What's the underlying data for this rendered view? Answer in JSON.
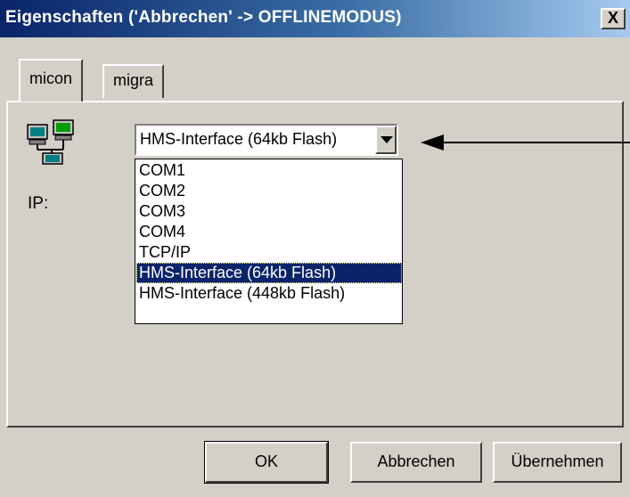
{
  "window": {
    "title": "Eigenschaften ('Abbrechen' -> OFFLINEMODUS)",
    "close_label": "X"
  },
  "tabs": [
    {
      "label": "micon",
      "active": true
    },
    {
      "label": "migra",
      "active": false
    }
  ],
  "panel": {
    "icon": "network-computers-icon",
    "ip_label": "IP:",
    "interface_combo": {
      "value": "HMS-Interface (64kb Flash)",
      "options": [
        "COM1",
        "COM2",
        "COM3",
        "COM4",
        "TCP/IP",
        "HMS-Interface (64kb Flash)",
        "HMS-Interface (448kb Flash)"
      ],
      "selected_index": 5
    }
  },
  "annotation": {
    "icon": "pointer-arrow-icon"
  },
  "buttons": {
    "ok": "OK",
    "cancel": "Abbrechen",
    "apply": "Übernehmen"
  },
  "colors": {
    "titlebar_start": "#0a246a",
    "titlebar_end": "#a6caf0",
    "selection": "#0a246a",
    "face": "#d4d0c8"
  }
}
